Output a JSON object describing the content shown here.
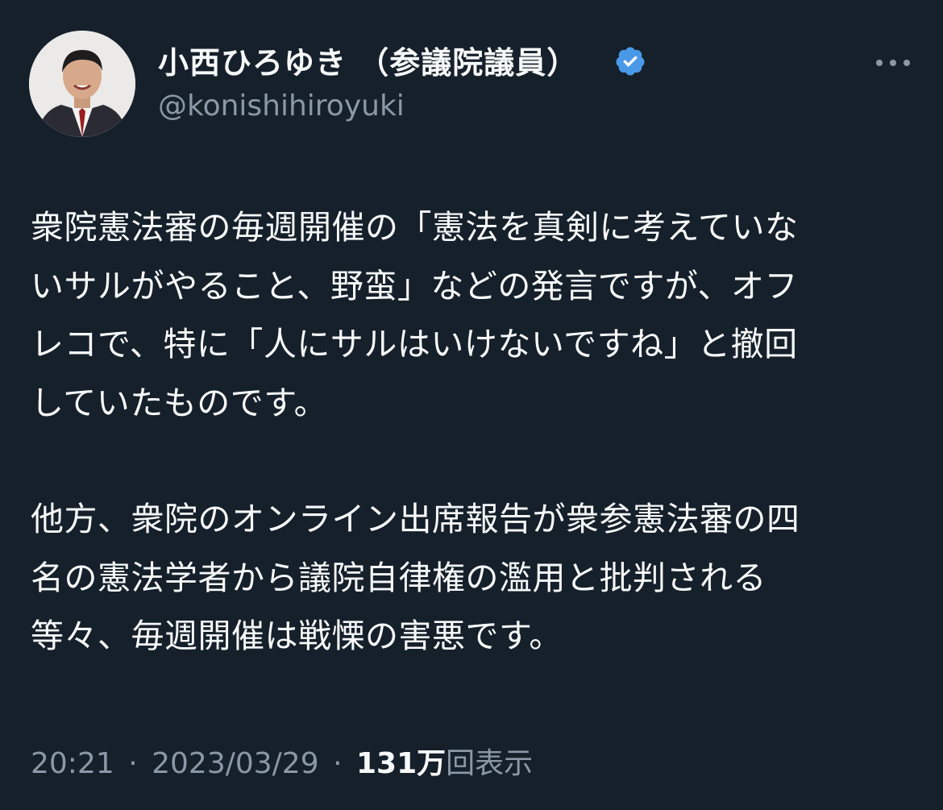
{
  "author": {
    "display_name": "小西ひろゆき （参議院議員）",
    "handle": "@konishihiroyuki",
    "verified": true,
    "badge_color": "#4a99e9",
    "avatar_icon": "profile-photo"
  },
  "more_icon": "more-horizontal-icon",
  "tweet": {
    "paragraphs": [
      "衆院憲法審の毎週開催の「憲法を真剣に考えていな\nいサルがやること、野蛮」などの発言ですが、オフ\nレコで、特に「人にサルはいけないですね」と撤回\nしていたものです。",
      "他方、衆院のオンライン出席報告が衆参憲法審の四\n名の憲法学者から議院自律権の濫用と批判される\n等々、毎週開催は戦慄の害悪です。"
    ]
  },
  "meta": {
    "time": "20:21",
    "separator": "·",
    "date": "2023/03/29",
    "views_count": "131万",
    "views_label": "回表示"
  },
  "colors": {
    "background": "#15202b",
    "primary_text": "#f7f9f9",
    "secondary_text": "#8b98a5"
  }
}
